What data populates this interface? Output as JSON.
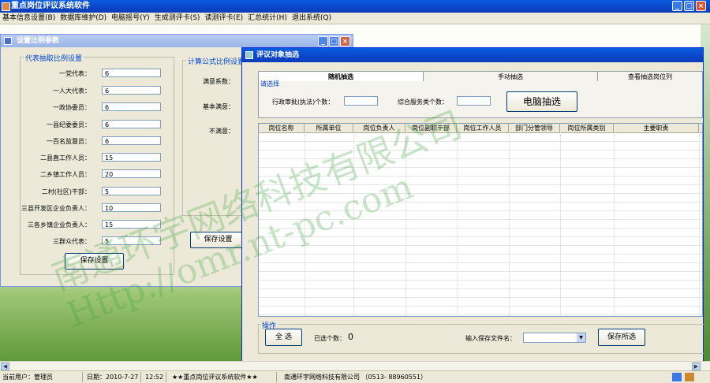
{
  "app": {
    "title": "重点岗位评议系统软件",
    "controls": {
      "minimize": "_",
      "maximize": "□",
      "close": "×"
    }
  },
  "menu": [
    "基本信息设置(B)",
    "数据库维护(D)",
    "电脑摇号(Y)",
    "生成测评卡(S)",
    "读测评卡(E)",
    "汇总统计(H)",
    "退出系统(Q)"
  ],
  "settings_window": {
    "title": "设置比例参数",
    "group1_title": "代表抽取比例设置",
    "fields": [
      {
        "label": "一党代表：",
        "value": "6"
      },
      {
        "label": "一人大代表：",
        "value": "6"
      },
      {
        "label": "一政协委员：",
        "value": "6"
      },
      {
        "label": "一县纪委委员：",
        "value": "6"
      },
      {
        "label": "一百名监督员：",
        "value": "6"
      },
      {
        "label": "二县直工作人员：",
        "value": "15"
      },
      {
        "label": "二乡镇工作人员：",
        "value": "20"
      },
      {
        "label": "二村(社区)干部：",
        "value": "5"
      },
      {
        "label": "三县开发区企业负责人：",
        "value": "10"
      },
      {
        "label": "三各乡镇企业负责人：",
        "value": "15"
      },
      {
        "label": "三群众代表：",
        "value": "5"
      }
    ],
    "save_button": "保存设置",
    "group2_title": "计算公式比例设置",
    "formula_labels": [
      "满意系数：",
      "基本满意：",
      "不满意："
    ],
    "save_button2": "保存设置"
  },
  "selection_window": {
    "title": "评议对象抽选",
    "tabs": [
      "随机抽选",
      "手动抽选",
      "查看抽选岗位列"
    ],
    "select_group": "请选择",
    "admin_label": "行政审批(执法)个数：",
    "service_label": "综合服务类个数：",
    "admin_value": "",
    "service_value": "",
    "draw_button": "电脑抽选",
    "columns": [
      "岗位名称",
      "所属单位",
      "岗位负责人",
      "岗位副职干部",
      "岗位工作人员",
      "部门分管领导",
      "岗位所属类别",
      "主要职责"
    ],
    "op_group": "操作",
    "select_all": "全 选",
    "selected_count_label": "已选个数：",
    "selected_count": "0",
    "filename_label": "输入保存文件名：",
    "filename_value": "",
    "save_selected": "保存所选"
  },
  "status": {
    "user": "当前用户：管理员",
    "date": "日期：2010-7-27",
    "time": "12:52",
    "software": "★★重点岗位评议系统软件★★",
    "company": "南通环宇网络科技有限公司 （0513- 88960551）"
  },
  "watermark": {
    "line1": "南通环宇网络科技有限公司",
    "line2": "Http://omr.nt-pc.com"
  },
  "colors": {
    "title_blue": "#0b45c8",
    "group_label": "#0046d5",
    "panel": "#ece9d8"
  }
}
